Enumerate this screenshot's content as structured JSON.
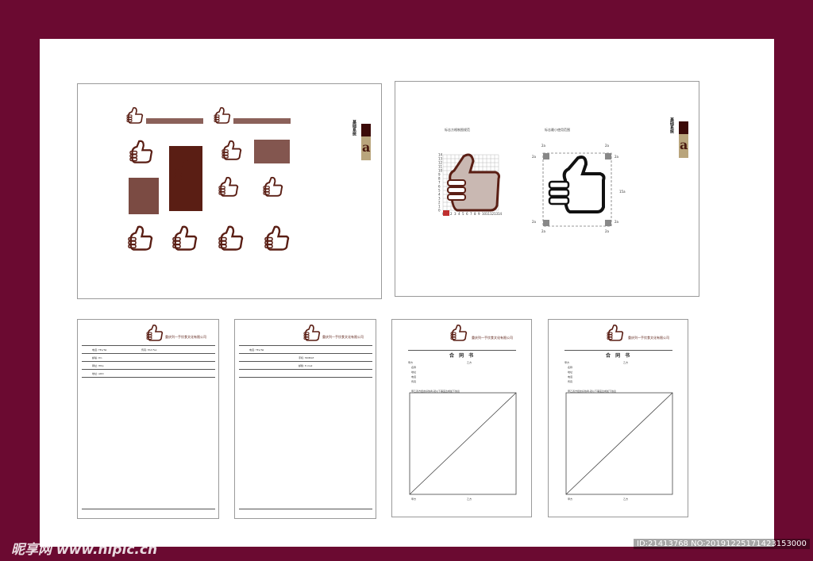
{
  "brand": {
    "company_name": "重庆列一手饮食文化有限公司",
    "slogan_cn": "誓成列一手",
    "sheet_heading": "基础系统",
    "sheet_subheading": "Basic System",
    "section_letter": "a",
    "label_grid": "标志方格制图规范",
    "label_safezone": "标志最小使用范围"
  },
  "grid_axis": {
    "y_ticks": [
      "14",
      "13",
      "12",
      "11",
      "10",
      "9",
      "8",
      "7",
      "6",
      "5",
      "4",
      "3",
      "2",
      "1",
      "0"
    ],
    "x_ticks": [
      "0",
      "1",
      "2",
      "3",
      "4",
      "5",
      "6",
      "7",
      "8",
      "9",
      "10",
      "11",
      "12",
      "13",
      "14"
    ]
  },
  "safezone": {
    "corner": "2a",
    "height": "15a"
  },
  "letterhead": {
    "fields": [
      "电话: TEL/Tel",
      "传真: FAX Tel",
      "邮编: P.C.",
      "网址: Http",
      "地址: ADD"
    ],
    "right_fields": [
      "传真: FAX Fax",
      "手机: MOBILE",
      "邮箱: E-mail"
    ]
  },
  "contract": {
    "title": "合 同 书",
    "parties": [
      "甲方",
      "乙方"
    ],
    "fields": [
      "名称",
      "地址",
      "电话",
      "传真"
    ],
    "note": "甲乙双方经友好协商,就以下事宜达成如下协议",
    "sign": [
      "甲方",
      "乙方"
    ]
  },
  "watermark": {
    "site": "昵享网 www.nipic.cn",
    "id": "ID:21413768 NO:20191225171423153000"
  }
}
